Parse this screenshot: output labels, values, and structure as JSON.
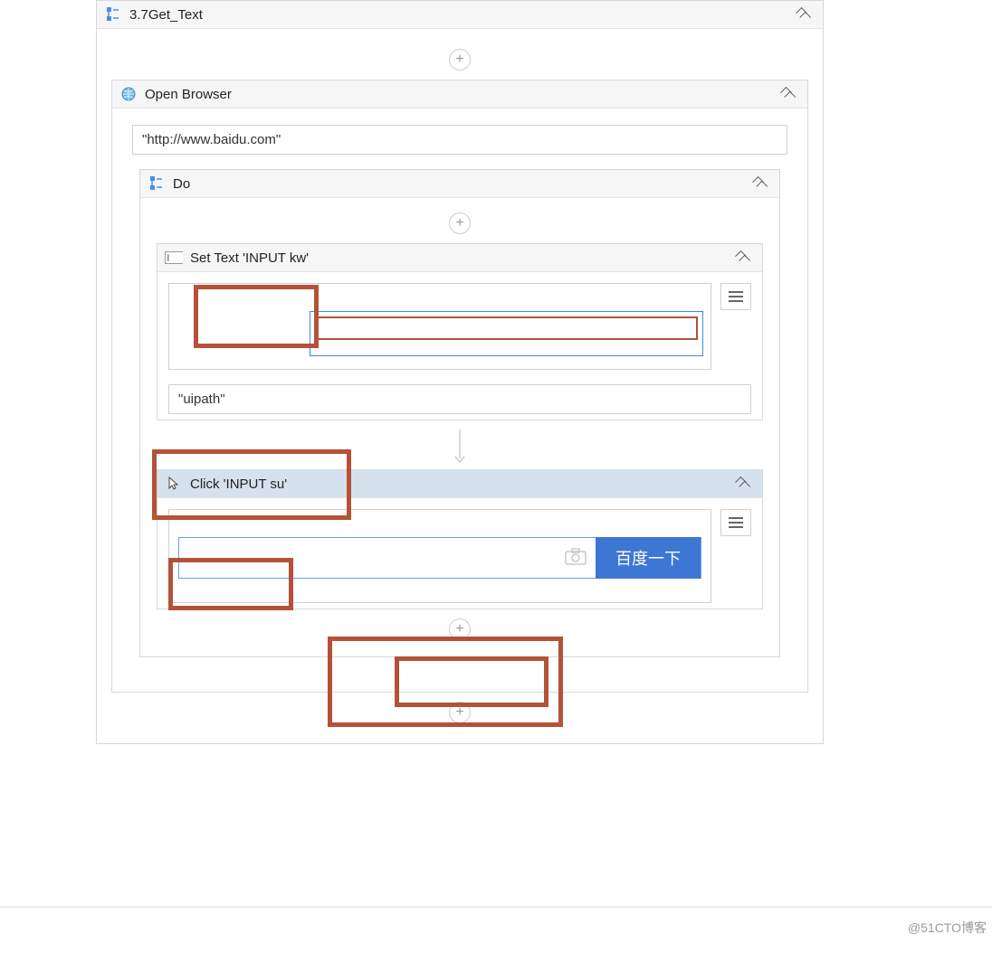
{
  "workflow": {
    "title": "3.7Get_Text"
  },
  "openBrowser": {
    "title": "Open Browser",
    "url": "\"http://www.baidu.com\""
  },
  "doBlock": {
    "title": "Do"
  },
  "setText": {
    "title": "Set Text 'INPUT  kw'",
    "text": "\"uipath\""
  },
  "click": {
    "title": "Click 'INPUT  su'",
    "buttonLabel": "百度一下"
  },
  "watermark": "@51CTO博客"
}
